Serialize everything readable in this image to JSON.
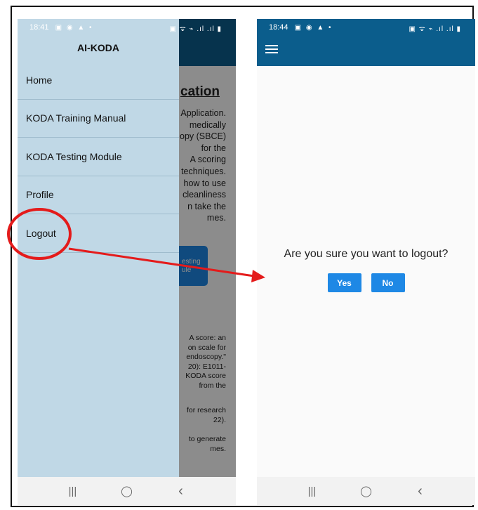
{
  "left_phone": {
    "status": {
      "time": "18:41",
      "left_icons": "▣ ◉ ▲ •",
      "right_icons": "▣ ᯤ ⌁ .ıl .ıl ▮"
    },
    "background": {
      "title_fragment": "cation",
      "paragraph1": [
        "Application.",
        "medically",
        "opy (SBCE)",
        "for the",
        "A scoring",
        "techniques.",
        "how to use",
        "cleanliness",
        "n take the",
        "mes."
      ],
      "testing_button": [
        "esting",
        "ule"
      ],
      "paragraph2": [
        "A score: an",
        "on scale for",
        "endoscopy.\"",
        "20): E1011-",
        "KODA score",
        "from the"
      ],
      "paragraph3": [
        "for research",
        "22)."
      ],
      "paragraph4": [
        "to generate",
        "mes."
      ]
    },
    "drawer": {
      "title": "AI-KODA",
      "items": [
        {
          "label": "Home"
        },
        {
          "label": "KODA Training Manual"
        },
        {
          "label": "KODA Testing Module"
        },
        {
          "label": "Profile"
        },
        {
          "label": "Logout"
        }
      ]
    },
    "nav": {
      "recents": "|||",
      "home": "◯",
      "back": "‹"
    }
  },
  "right_phone": {
    "status": {
      "time": "18:44",
      "left_icons": "▣ ◉ ▲ •",
      "right_icons": "▣ ᯤ ⌁ .ıl .ıl ▮"
    },
    "dialog": {
      "question": "Are you sure you want to logout?",
      "yes_label": "Yes",
      "no_label": "No"
    },
    "nav": {
      "recents": "|||",
      "home": "◯",
      "back": "‹"
    }
  },
  "colors": {
    "appbar": "#0b5d8c",
    "drawer": "#c0d8e6",
    "button": "#1e88e5",
    "annotation": "#e41b1b"
  },
  "icons": {
    "menu": "hamburger-menu-icon"
  }
}
